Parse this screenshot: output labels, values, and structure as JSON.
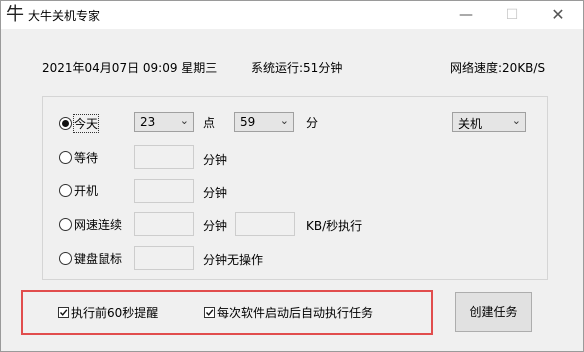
{
  "window": {
    "title": "大牛关机专家",
    "app_icon": "牛",
    "minimize_glyph": "—",
    "maximize_glyph": "☐",
    "close_glyph": "✕"
  },
  "info": {
    "datetime": "2021年04月07日 09:09 星期三",
    "uptime": "系统运行:51分钟",
    "speed": "网络速度:20KB/S"
  },
  "options": {
    "today": {
      "label": "今天",
      "checked": true
    },
    "hour_value": "23",
    "hour_unit": "点",
    "minute_value": "59",
    "minute_unit": "分",
    "action_value": "关机",
    "wait": {
      "label": "等待",
      "unit": "分钟"
    },
    "boot": {
      "label": "开机",
      "unit": "分钟"
    },
    "netspeed": {
      "label": "网速连续",
      "unit": "分钟",
      "rate_unit": "KB/秒执行"
    },
    "input": {
      "label": "键盘鼠标",
      "unit": "分钟无操作"
    }
  },
  "footer": {
    "remind_label": "执行前60秒提醒",
    "remind_checked": true,
    "autorun_label": "每次软件启动后自动执行任务",
    "autorun_checked": true,
    "create_button": "创建任务"
  }
}
